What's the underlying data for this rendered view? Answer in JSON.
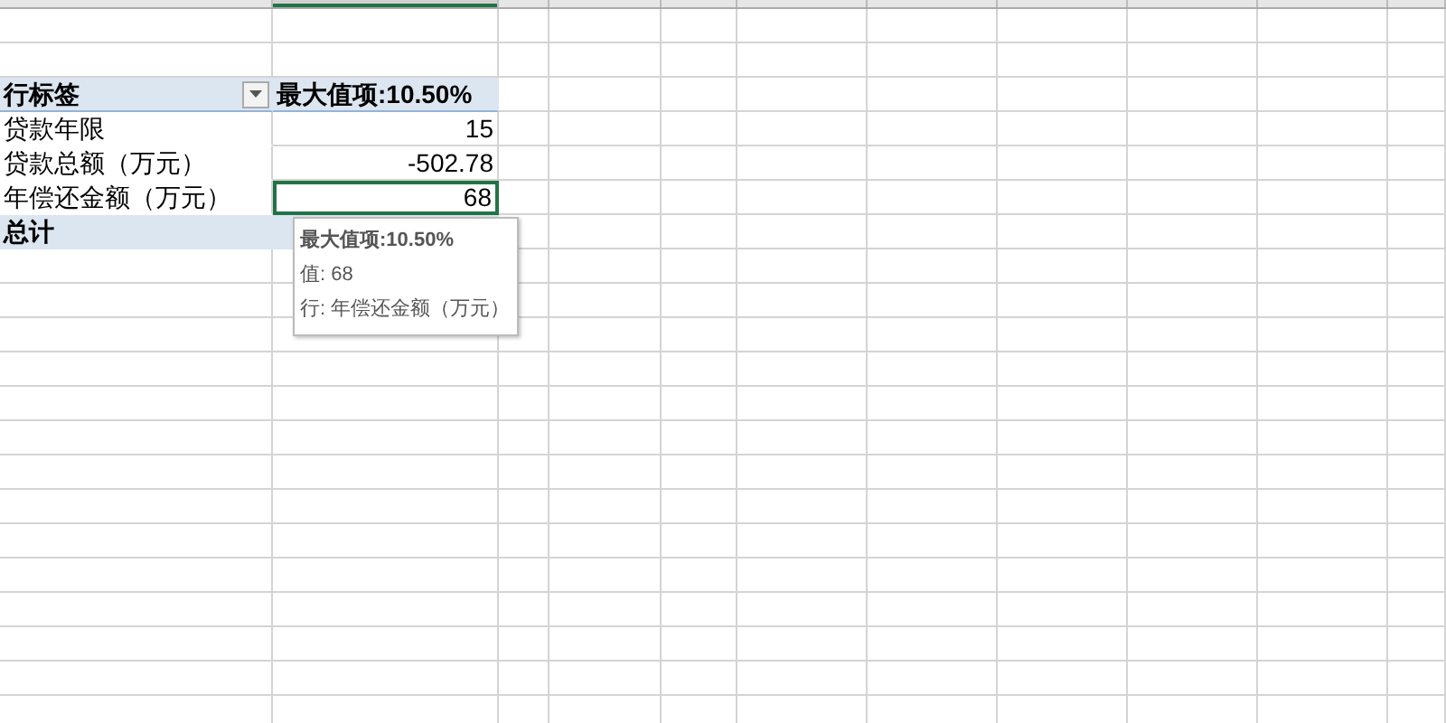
{
  "pivot": {
    "header": {
      "row_label": "行标签",
      "value_label": "最大值项:10.50%"
    },
    "rows": [
      {
        "label": "贷款年限",
        "value": "15",
        "selected": false
      },
      {
        "label": "贷款总额（万元）",
        "value": "-502.78",
        "selected": false
      },
      {
        "label": "年偿还金额（万元）",
        "value": "68",
        "selected": true
      }
    ],
    "total": {
      "label": "总计"
    }
  },
  "tooltip": {
    "title": "最大值项:10.50%",
    "lines": [
      "值: 68",
      "行: 年偿还金额（万元）"
    ]
  }
}
